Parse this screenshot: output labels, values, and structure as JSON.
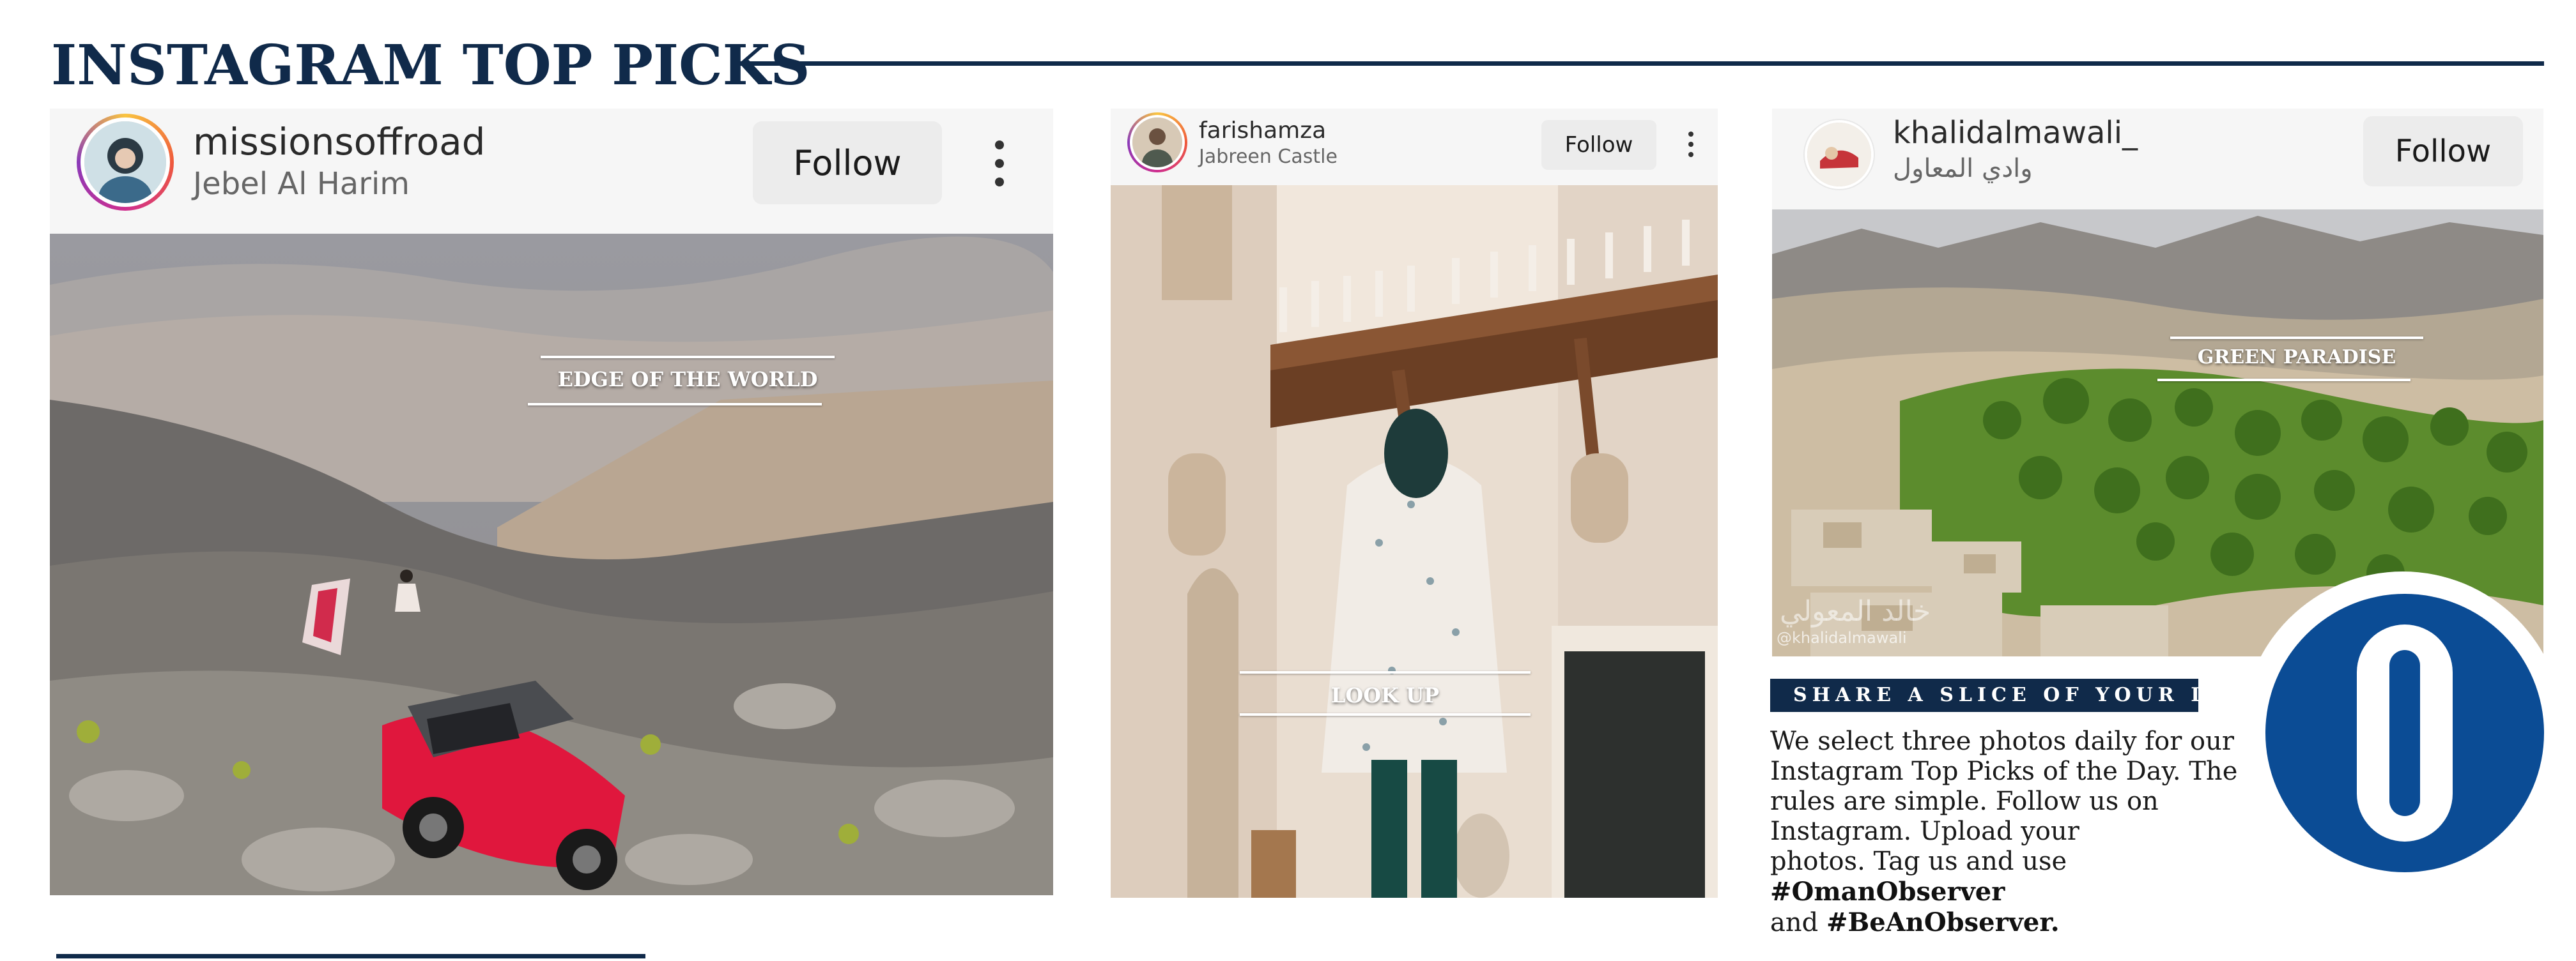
{
  "header": {
    "title": "INSTAGRAM TOP PICKS"
  },
  "posts": [
    {
      "username": "missionsoffroad",
      "location": "Jebel Al Harim",
      "follow_label": "Follow",
      "photo_label": "EDGE OF THE WORLD"
    },
    {
      "username": "farishamza",
      "location": "Jabreen Castle",
      "follow_label": "Follow",
      "photo_label": "LOOK UP"
    },
    {
      "username": "khalidalmawali_",
      "location": "وادي المعاول",
      "follow_label": "Follow",
      "photo_label": "GREEN PARADISE",
      "watermark_arabic": "خالد المعولي",
      "watermark_handle": "@khalidalmawali"
    }
  ],
  "share": {
    "banner": "SHARE A SLICE OF YOUR LIFE",
    "body_lines": [
      "We select three photos daily for our",
      "Instagram Top Picks of the Day. The",
      "rules are simple. Follow us on",
      "Instagram. Upload your",
      "photos. Tag us and use "
    ],
    "hashtag1": "#OmanObserver",
    "and_text": "and ",
    "hashtag2": "#BeAnObserver."
  },
  "colors": {
    "brand_navy": "#102a4a",
    "logo_blue": "#0b4c95",
    "follow_bg": "#ececec"
  },
  "icons": [
    "more-options-icon",
    "observer-logo"
  ]
}
